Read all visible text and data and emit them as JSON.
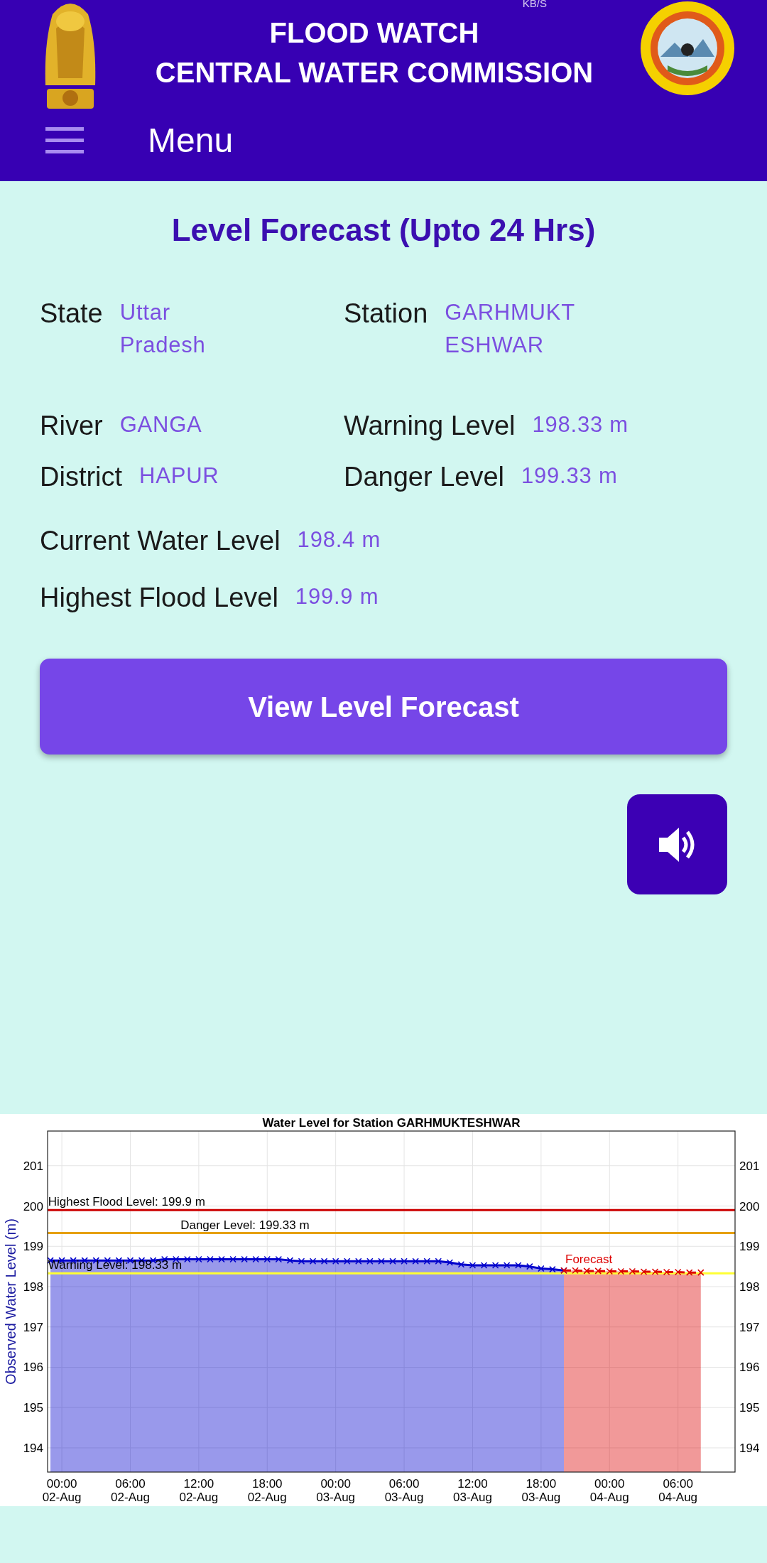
{
  "status_bar": {
    "speed": "KB/S"
  },
  "header": {
    "title_lines": [
      "FLOOD WATCH",
      "CENTRAL WATER COMMISSION"
    ],
    "menu_label": "Menu"
  },
  "title": "Level Forecast (Upto 24 Hrs)",
  "field_rows": [
    [
      {
        "label": "State",
        "value": "Uttar Pradesh"
      },
      {
        "label": "Station",
        "value": "GARHMUKTESHWAR"
      }
    ],
    [
      {
        "label": "River",
        "value": "GANGA"
      },
      {
        "label": "Warning Level",
        "value": "198.33 m"
      }
    ],
    [
      {
        "label": "District",
        "value": "HAPUR"
      },
      {
        "label": "Danger Level",
        "value": "199.33 m"
      }
    ]
  ],
  "level_rows": [
    {
      "label": "Current Water Level",
      "value": "198.4 m"
    },
    {
      "label": "Highest Flood Level",
      "value": "199.9 m"
    }
  ],
  "forecast_button": "View Level Forecast",
  "sound_button": {
    "muted": false
  },
  "chart_data": {
    "type": "area",
    "title": "Water Level for Station GARHMUKTESHWAR",
    "ylabel": "Observed Water Level (m)",
    "ylim": [
      193.4,
      201.86
    ],
    "y2lim": [
      193.4,
      201.86
    ],
    "grid": true,
    "categories": [
      null,
      "00:00\n02-Aug",
      null,
      null,
      null,
      null,
      null,
      "06:00\n02-Aug",
      null,
      null,
      null,
      null,
      null,
      "12:00\n02-Aug",
      null,
      null,
      null,
      null,
      null,
      "18:00\n02-Aug",
      null,
      null,
      null,
      null,
      null,
      "00:00\n03-Aug",
      null,
      null,
      null,
      null,
      null,
      "06:00\n03-Aug",
      null,
      null,
      null,
      null,
      null,
      "12:00\n03-Aug",
      null,
      null,
      null,
      null,
      null,
      "18:00\n03-Aug",
      null,
      null,
      null,
      null,
      null,
      "00:00\n04-Aug",
      null,
      null,
      null,
      null,
      null,
      "06:00\n04-Aug",
      null,
      null
    ],
    "yticks": [
      194,
      195,
      196,
      197,
      198,
      199,
      200,
      201
    ],
    "y2ticks": [
      194,
      195,
      196,
      197,
      198,
      199,
      200,
      201
    ],
    "series": [
      {
        "color": "#0000cc",
        "marker": "x",
        "line_style": "solid",
        "values": [
          198.65,
          198.65,
          198.65,
          198.65,
          198.65,
          198.65,
          198.65,
          198.65,
          198.65,
          198.65,
          198.68,
          198.68,
          198.68,
          198.68,
          198.68,
          198.68,
          198.68,
          198.68,
          198.68,
          198.68,
          198.68,
          198.65,
          198.63,
          198.63,
          198.63,
          198.63,
          198.63,
          198.63,
          198.63,
          198.63,
          198.63,
          198.63,
          198.63,
          198.63,
          198.63,
          198.6,
          198.55,
          198.53,
          198.53,
          198.53,
          198.53,
          198.53,
          198.5,
          198.45,
          198.43,
          198.4,
          null,
          null,
          null,
          null,
          null,
          null,
          null,
          null,
          null,
          null,
          null,
          null
        ]
      },
      {
        "name": "Forecast",
        "color": "#dd0000",
        "marker": "x",
        "line_style": "dashed",
        "values": [
          null,
          null,
          null,
          null,
          null,
          null,
          null,
          null,
          null,
          null,
          null,
          null,
          null,
          null,
          null,
          null,
          null,
          null,
          null,
          null,
          null,
          null,
          null,
          null,
          null,
          null,
          null,
          null,
          null,
          null,
          null,
          null,
          null,
          null,
          null,
          null,
          null,
          null,
          null,
          null,
          null,
          null,
          null,
          null,
          null,
          198.4,
          198.4,
          198.39,
          198.39,
          198.38,
          198.38,
          198.38,
          198.37,
          198.37,
          198.36,
          198.36,
          198.35,
          198.35
        ]
      }
    ],
    "ref_lines": [
      {
        "axis": "y",
        "value": 199.9,
        "label": "Highest Flood Level: 199.9 m",
        "color": "#cc0000"
      },
      {
        "axis": "y",
        "value": 199.33,
        "label": "Danger Level: 199.33 m",
        "color": "#e6a000"
      },
      {
        "axis": "y",
        "value": 198.33,
        "label": "Warning Level: 198.33 m",
        "color": "#ffff33"
      }
    ]
  }
}
